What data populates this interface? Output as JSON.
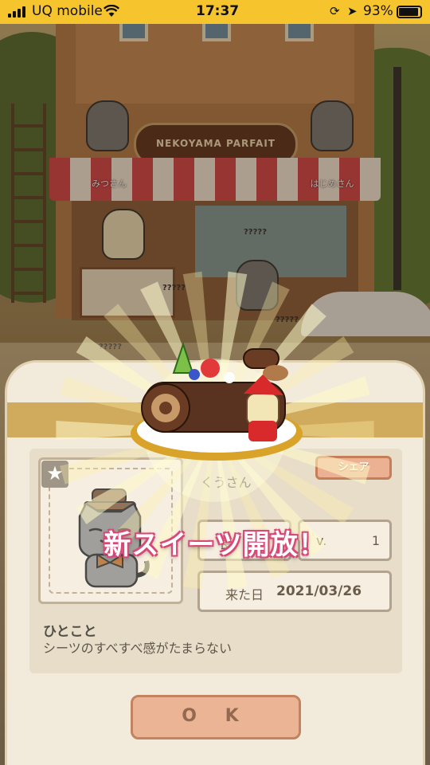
{
  "status_bar": {
    "carrier": "UQ mobile",
    "time": "17:37",
    "battery_percent": "93%",
    "battery_level": 0.93
  },
  "scene": {
    "shop_sign": "NEKOYAMA PARFAIT",
    "staff_left": "みつさん",
    "staff_right": "はじめさん",
    "unknown_labels": [
      "?????",
      "?????",
      "?????",
      "?????"
    ]
  },
  "profile": {
    "name": "くうさん",
    "share_label": "シェア",
    "level_key": "長",
    "lv_key": "v.",
    "lv_value": "1",
    "visit_key": "来た日",
    "visit_date": "2021/03/26",
    "comment_title": "ひとこと",
    "comment_text": "シーツのすべすべ感がたまらない",
    "ok_label": "O K",
    "star_icon": "★"
  },
  "reveal": {
    "banner": "新スイーツ開放！"
  },
  "colors": {
    "status_bar": "#f6c42c",
    "banner_outline": "#d84a78",
    "ok_button": "#e7a684",
    "share_button": "#e8a080"
  }
}
